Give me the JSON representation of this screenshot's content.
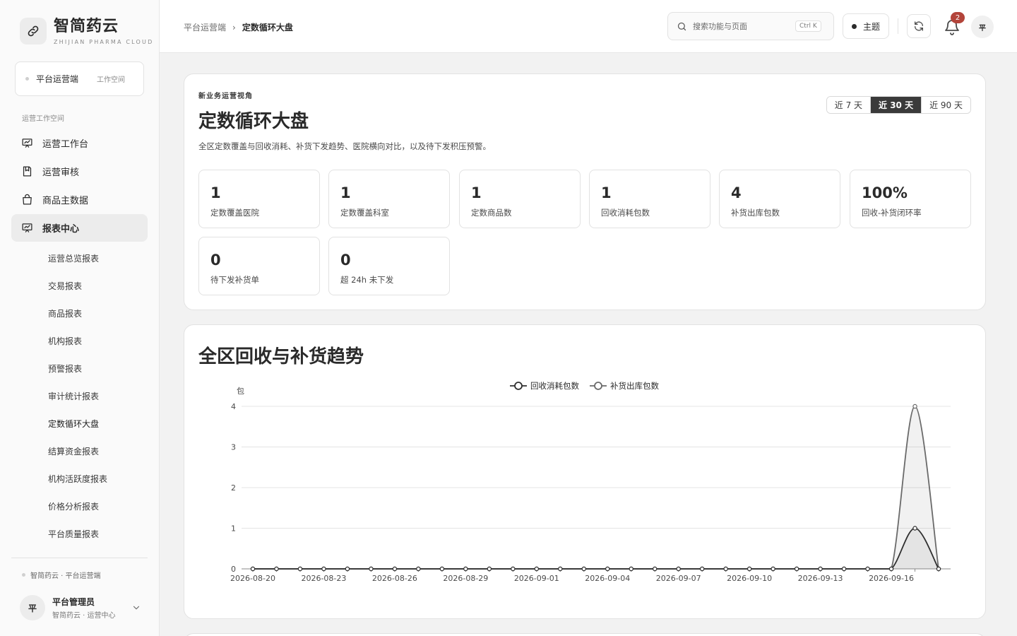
{
  "brand": {
    "name": "智简药云",
    "subtitle": "ZHIJIAN PHARMA CLOUD",
    "logo_icon": "link-icon"
  },
  "workspace": {
    "name": "平台运营端",
    "tag": "工作空间"
  },
  "sidebar": {
    "section_title": "运营工作空间",
    "items": [
      {
        "label": "运营工作台",
        "icon": "dashboard-icon",
        "active": false
      },
      {
        "label": "运营审核",
        "icon": "review-icon",
        "active": false
      },
      {
        "label": "商品主数据",
        "icon": "bag-icon",
        "active": false
      },
      {
        "label": "报表中心",
        "icon": "report-icon",
        "active": true
      }
    ],
    "sub_items": [
      {
        "label": "运营总览报表"
      },
      {
        "label": "交易报表"
      },
      {
        "label": "商品报表"
      },
      {
        "label": "机构报表"
      },
      {
        "label": "预警报表"
      },
      {
        "label": "审计统计报表"
      },
      {
        "label": "定数循环大盘",
        "current": true
      },
      {
        "label": "结算资金报表"
      },
      {
        "label": "机构活跃度报表"
      },
      {
        "label": "价格分析报表"
      },
      {
        "label": "平台质量报表"
      }
    ],
    "org_line": "智简药云 · 平台运营端"
  },
  "user": {
    "avatar": "平",
    "name": "平台管理员",
    "sub": "智简药云 · 运营中心"
  },
  "header": {
    "breadcrumb_root": "平台运营端",
    "breadcrumb_sep": "›",
    "breadcrumb_current": "定数循环大盘",
    "search_placeholder": "搜索功能与页面",
    "search_shortcut": "Ctrl K",
    "theme_label": "主题",
    "notification_count": "2",
    "avatar": "平"
  },
  "page": {
    "eyebrow": "新业务运营视角",
    "title": "定数循环大盘",
    "description": "全区定数覆盖与回收消耗、补货下发趋势、医院横向对比，以及待下发积压预警。",
    "ranges": [
      {
        "label": "近 7 天",
        "active": false
      },
      {
        "label": "近 30 天",
        "active": true
      },
      {
        "label": "近 90 天",
        "active": false
      }
    ],
    "stats": [
      {
        "value": "1",
        "label": "定数覆盖医院"
      },
      {
        "value": "1",
        "label": "定数覆盖科室"
      },
      {
        "value": "1",
        "label": "定数商品数"
      },
      {
        "value": "1",
        "label": "回收消耗包数"
      },
      {
        "value": "4",
        "label": "补货出库包数"
      },
      {
        "value": "100%",
        "label": "回收-补货闭环率"
      },
      {
        "value": "0",
        "label": "待下发补货单"
      },
      {
        "value": "0",
        "label": "超 24h 未下发"
      }
    ]
  },
  "chart_data": {
    "type": "line",
    "title": "全区回收与补货趋势",
    "ylabel": "包",
    "ylim": [
      0,
      4
    ],
    "yticks": [
      0,
      1,
      2,
      3,
      4
    ],
    "legend_position": "top-center",
    "grid": true,
    "x": [
      "2026-08-20",
      "2026-08-21",
      "2026-08-22",
      "2026-08-23",
      "2026-08-24",
      "2026-08-25",
      "2026-08-26",
      "2026-08-27",
      "2026-08-28",
      "2026-08-29",
      "2026-08-30",
      "2026-08-31",
      "2026-09-01",
      "2026-09-02",
      "2026-09-03",
      "2026-09-04",
      "2026-09-05",
      "2026-09-06",
      "2026-09-07",
      "2026-09-08",
      "2026-09-09",
      "2026-09-10",
      "2026-09-11",
      "2026-09-12",
      "2026-09-13",
      "2026-09-14",
      "2026-09-15",
      "2026-09-16",
      "2026-09-17",
      "2026-09-18"
    ],
    "xtick_labels": [
      "2026-08-20",
      "2026-08-23",
      "2026-08-26",
      "2026-08-29",
      "2026-09-01",
      "2026-09-04",
      "2026-09-07",
      "2026-09-10",
      "2026-09-13",
      "2026-09-16"
    ],
    "series": [
      {
        "name": "回收消耗包数",
        "color": "#2f2f2f",
        "values": [
          0,
          0,
          0,
          0,
          0,
          0,
          0,
          0,
          0,
          0,
          0,
          0,
          0,
          0,
          0,
          0,
          0,
          0,
          0,
          0,
          0,
          0,
          0,
          0,
          0,
          0,
          0,
          0,
          1,
          0
        ]
      },
      {
        "name": "补货出库包数",
        "color": "#6a6a6a",
        "values": [
          0,
          0,
          0,
          0,
          0,
          0,
          0,
          0,
          0,
          0,
          0,
          0,
          0,
          0,
          0,
          0,
          0,
          0,
          0,
          0,
          0,
          0,
          0,
          0,
          0,
          0,
          0,
          0,
          4,
          0
        ]
      }
    ]
  }
}
